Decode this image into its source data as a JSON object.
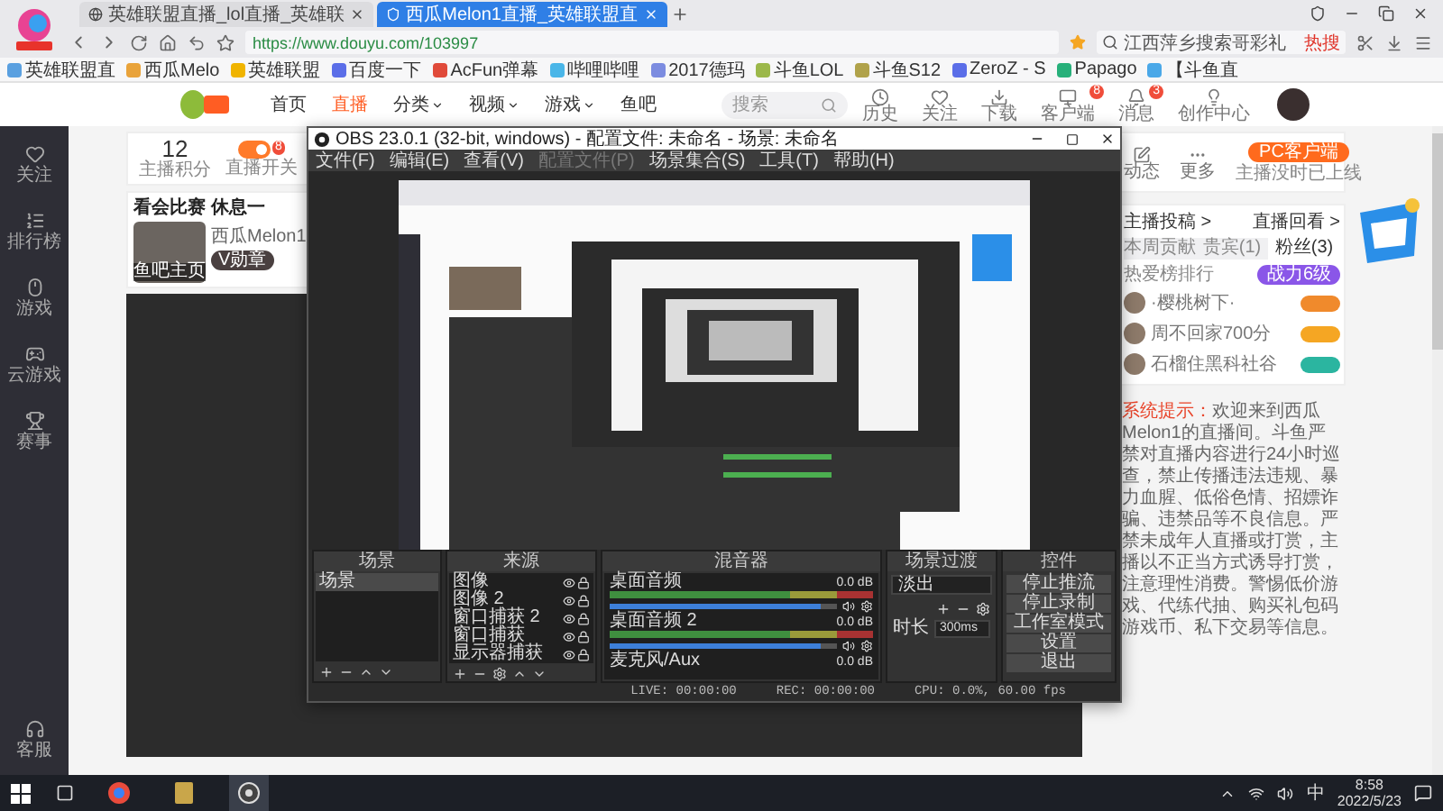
{
  "browser": {
    "tabs": [
      {
        "title": "英雄联盟直播_lol直播_英雄联",
        "selected": false
      },
      {
        "title": "西瓜Melon1直播_英雄联盟直",
        "selected": true
      }
    ],
    "url": "https://www.douyu.com/103997",
    "search_hint": "江西萍乡搜索哥彩礼",
    "search_tag": "热搜",
    "bookmarks": [
      "英雄联盟直",
      "西瓜Melo",
      "英雄联盟",
      "百度一下",
      "AcFun弹幕",
      "哔哩哔哩",
      "2017德玛",
      "斗鱼LOL",
      "斗鱼S12",
      "ZeroZ - S",
      "Papago",
      "【斗鱼直"
    ]
  },
  "site": {
    "nav": [
      {
        "label": "首页",
        "selected": false,
        "dropdown": false
      },
      {
        "label": "直播",
        "selected": true,
        "dropdown": false
      },
      {
        "label": "分类",
        "selected": false,
        "dropdown": true
      },
      {
        "label": "视频",
        "selected": false,
        "dropdown": true
      },
      {
        "label": "游戏",
        "selected": false,
        "dropdown": true
      },
      {
        "label": "鱼吧",
        "selected": false,
        "dropdown": false
      }
    ],
    "search": {
      "placeholder": "搜索"
    },
    "actions": [
      {
        "label": "历史"
      },
      {
        "label": "关注"
      },
      {
        "label": "下载"
      },
      {
        "label": "客户端",
        "badge": "8"
      },
      {
        "label": "消息",
        "badge": "3"
      },
      {
        "label": "创作中心"
      }
    ]
  },
  "sidebar": {
    "items": [
      "关注",
      "排行榜",
      "游戏",
      "云游戏",
      "赛事"
    ],
    "help": "客服"
  },
  "stats": {
    "score": "12",
    "score_label": "主播积分",
    "switch_label": "直播开关",
    "switch_badge": "8"
  },
  "streamer": {
    "title": "看会比赛 休息一",
    "name": "西瓜Melon1",
    "medal": "V勋章",
    "photo_tags": [
      "鱼吧",
      "主页"
    ]
  },
  "side_panel": {
    "actions": [
      "动态",
      "更多"
    ],
    "client_button": "PC客户端",
    "client_note": "主播没时已上线",
    "links": [
      "主播投稿 >",
      "直播回看 >"
    ],
    "tabs": [
      {
        "label": "本周贡献",
        "selected": false
      },
      {
        "label": "贵宾(1)",
        "selected": false
      },
      {
        "label": "粉丝(3)",
        "selected": true
      }
    ],
    "rank_label": "热爱榜排行",
    "rank_button": "战力6级",
    "fans": [
      {
        "name": "·樱桃树下·",
        "color": "#f08a2c"
      },
      {
        "name": "周不回家700分",
        "color": "#f5a623"
      },
      {
        "name": "石榴住黑科社谷",
        "color": "#2bb5a0"
      }
    ],
    "notice": {
      "label": "系统提示：",
      "text": "欢迎来到西瓜Melon1的直播间。斗鱼严禁对直播内容进行24小时巡查，禁止传播违法违规、暴力血腥、低俗色情、招嫖诈骗、违禁品等不良信息。严禁未成年人直播或打赏，主播以不正当方式诱导打赏，注意理性消费。警惕低价游戏、代练代抽、购买礼包码游戏币、私下交易等信息。"
    }
  },
  "obs": {
    "title": "OBS 23.0.1 (32-bit, windows) - 配置文件: 未命名 - 场景: 未命名",
    "menu": [
      {
        "label": "文件(F)",
        "disabled": false
      },
      {
        "label": "编辑(E)",
        "disabled": false
      },
      {
        "label": "查看(V)",
        "disabled": false
      },
      {
        "label": "配置文件(P)",
        "disabled": true
      },
      {
        "label": "场景集合(S)",
        "disabled": false
      },
      {
        "label": "工具(T)",
        "disabled": false
      },
      {
        "label": "帮助(H)",
        "disabled": false
      }
    ],
    "scenes": {
      "title": "场景",
      "items": [
        {
          "label": "场景",
          "selected": true
        }
      ]
    },
    "sources": {
      "title": "来源",
      "items": [
        "图像",
        "图像 2",
        "窗口捕获 2",
        "窗口捕获",
        "显示器捕获"
      ]
    },
    "mixer": {
      "title": "混音器",
      "channels": [
        {
          "name": "桌面音频",
          "reading": "0.0 dB",
          "level": 0.93
        },
        {
          "name": "桌面音频 2",
          "reading": "0.0 dB",
          "level": 0.93
        },
        {
          "name": "麦克风/Aux",
          "reading": "0.0 dB"
        }
      ]
    },
    "transitions": {
      "title": "场景过渡",
      "current": "淡出",
      "duration_label": "时长",
      "duration": "300ms"
    },
    "controls": {
      "title": "控件",
      "buttons": [
        "停止推流",
        "停止录制",
        "工作室模式",
        "设置",
        "退出"
      ]
    },
    "status": [
      "LIVE: 00:00:00",
      "REC: 00:00:00",
      "CPU: 0.0%, 60.00 fps"
    ]
  },
  "taskbar": {
    "ime": "中",
    "time": "8:58",
    "date": "2022/5/23"
  }
}
